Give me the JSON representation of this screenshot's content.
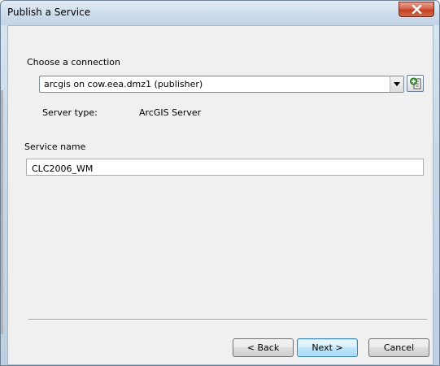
{
  "window": {
    "title": "Publish a Service"
  },
  "connection": {
    "heading": "Choose a connection",
    "selected": "arcgis on cow.eea.dmz1 (publisher)",
    "server_type_label": "Server type:",
    "server_type_value": "ArcGIS Server"
  },
  "service": {
    "heading": "Service name",
    "name_value": "CLC2006_WM"
  },
  "buttons": {
    "back": "< Back",
    "next": "Next >",
    "cancel": "Cancel"
  },
  "icons": {
    "close": "close-icon",
    "dropdown": "chevron-down-icon",
    "add_connection": "add-server-connection-icon"
  },
  "colors": {
    "title_gradient_top": "#e4edf6",
    "close_button": "#c1401f",
    "dialog_body": "#f0f0f0",
    "default_button_border": "#3c7fb1"
  }
}
